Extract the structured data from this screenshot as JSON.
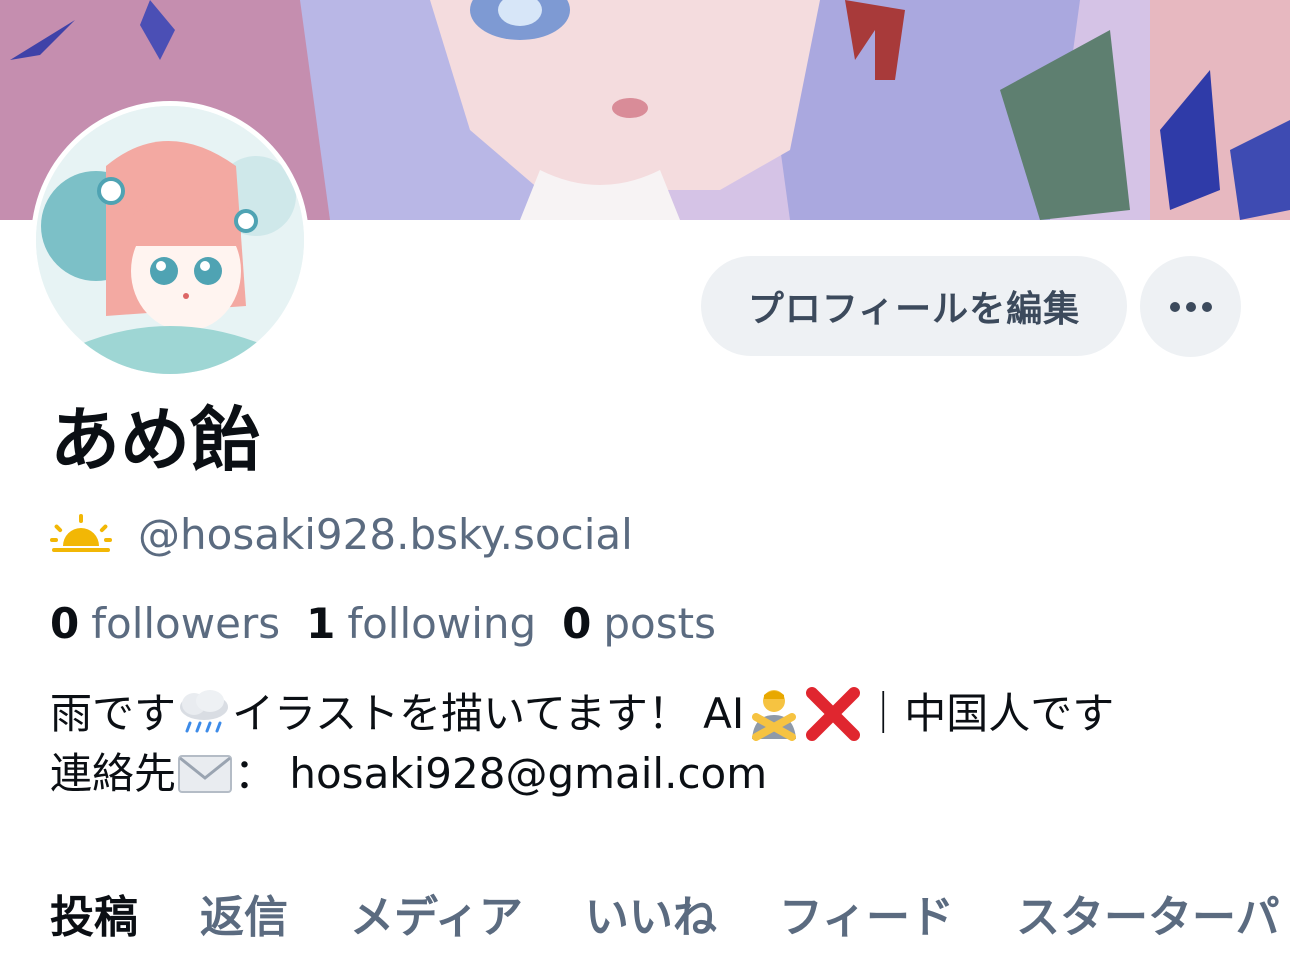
{
  "profile": {
    "display_name": "あめ飴",
    "handle": "@hosaki928.bsky.social",
    "handle_icon": "sunrise-icon"
  },
  "actions": {
    "edit_profile_label": "プロフィールを編集",
    "more_icon": "ellipsis-icon"
  },
  "stats": {
    "followers_count": "0",
    "followers_label": "followers",
    "following_count": "1",
    "following_label": "following",
    "posts_count": "0",
    "posts_label": "posts"
  },
  "bio": {
    "line1_part1": "雨です",
    "line1_part2": "イラストを描いてます！ AI",
    "line1_part3": "｜中国人です",
    "line2_part1": "連絡先",
    "line2_part2": "： hosaki928@gmail.com"
  },
  "tabs": [
    {
      "label": "投稿",
      "active": true
    },
    {
      "label": "返信",
      "active": false
    },
    {
      "label": "メディア",
      "active": false
    },
    {
      "label": "いいね",
      "active": false
    },
    {
      "label": "フィード",
      "active": false
    },
    {
      "label": "スターターパ",
      "active": false
    }
  ],
  "colors": {
    "secondary_text": "#5b6b80",
    "button_bg": "#eef1f4",
    "primary_text": "#0b0f14"
  }
}
